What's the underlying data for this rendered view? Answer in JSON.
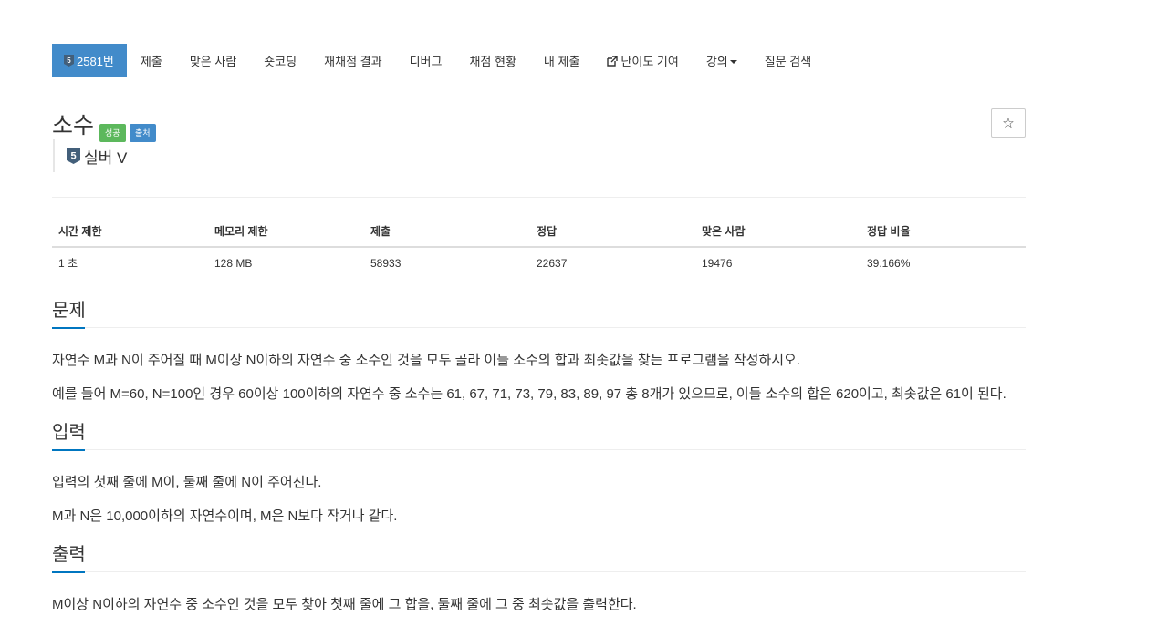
{
  "nav": {
    "problem_number": "2581번",
    "items": [
      {
        "label": "제출"
      },
      {
        "label": "맞은 사람"
      },
      {
        "label": "숏코딩"
      },
      {
        "label": "재채점 결과"
      },
      {
        "label": "디버그"
      },
      {
        "label": "채점 현황"
      },
      {
        "label": "내 제출"
      },
      {
        "label": "난이도 기여"
      },
      {
        "label": "강의"
      },
      {
        "label": "질문 검색"
      }
    ]
  },
  "problem": {
    "title": "소수",
    "label_success": "성공",
    "label_source": "출처",
    "tier_number": "5",
    "tier": "실버 V"
  },
  "limits_table": {
    "headers": [
      "시간 제한",
      "메모리 제한",
      "제출",
      "정답",
      "맞은 사람",
      "정답 비율"
    ],
    "row": [
      "1 초",
      "128 MB",
      "58933",
      "22637",
      "19476",
      "39.166%"
    ]
  },
  "sections": {
    "description": {
      "heading": "문제",
      "paragraphs": [
        "자연수 M과 N이 주어질 때 M이상 N이하의 자연수 중 소수인 것을 모두 골라 이들 소수의 합과 최솟값을 찾는 프로그램을 작성하시오.",
        "예를 들어 M=60, N=100인 경우 60이상 100이하의 자연수 중 소수는 61, 67, 71, 73, 79, 83, 89, 97 총 8개가 있으므로, 이들 소수의 합은 620이고, 최솟값은 61이 된다."
      ]
    },
    "input": {
      "heading": "입력",
      "paragraphs": [
        "입력의 첫째 줄에 M이, 둘째 줄에 N이 주어진다.",
        "M과 N은 10,000이하의 자연수이며, M은 N보다 작거나 같다."
      ]
    },
    "output": {
      "heading": "출력",
      "paragraphs": [
        "M이상 N이하의 자연수 중 소수인 것을 모두 찾아 첫째 줄에 그 합을, 둘째 줄에 그 중 최솟값을 출력한다."
      ]
    }
  },
  "colors": {
    "primary": "#428bca",
    "success": "#5cb85c",
    "section_underline": "#0076c0",
    "tier_silver": "#435f7a"
  }
}
